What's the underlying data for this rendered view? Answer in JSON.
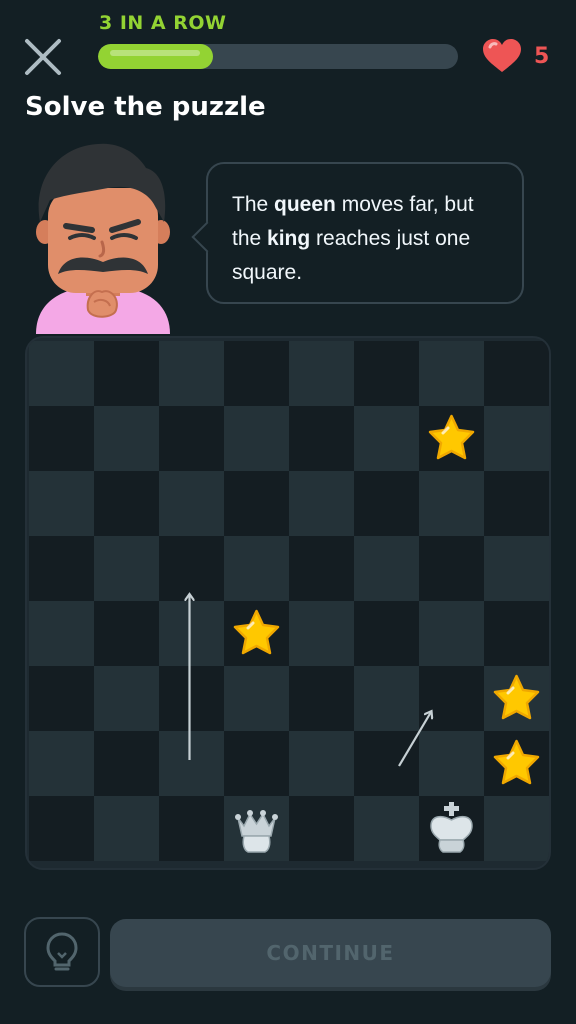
{
  "header": {
    "streak_label": "3 IN A ROW",
    "progress_fraction": 0.32,
    "progress_color": "#93d333",
    "hearts_count": "5",
    "heart_color": "#ee5555"
  },
  "title": "Solve the puzzle",
  "speech": {
    "part1": "The ",
    "bold1": "queen",
    "part2": " moves far, but the ",
    "bold2": "king",
    "part3": " reaches just one square."
  },
  "board": {
    "size": 8,
    "light_color": "#243238",
    "dark_color": "#141d22",
    "pieces": [
      {
        "name": "queen",
        "icon": "queen-piece-icon",
        "col": 3,
        "row": 7
      },
      {
        "name": "king",
        "icon": "king-piece-icon",
        "col": 6,
        "row": 7
      }
    ],
    "stars": [
      {
        "col": 6,
        "row": 1
      },
      {
        "col": 3,
        "row": 4
      },
      {
        "col": 7,
        "row": 5
      },
      {
        "col": 7,
        "row": 6
      }
    ],
    "star_color": "#ffc800"
  },
  "footer": {
    "hint_icon": "lightbulb-icon",
    "continue_label": "CONTINUE"
  }
}
